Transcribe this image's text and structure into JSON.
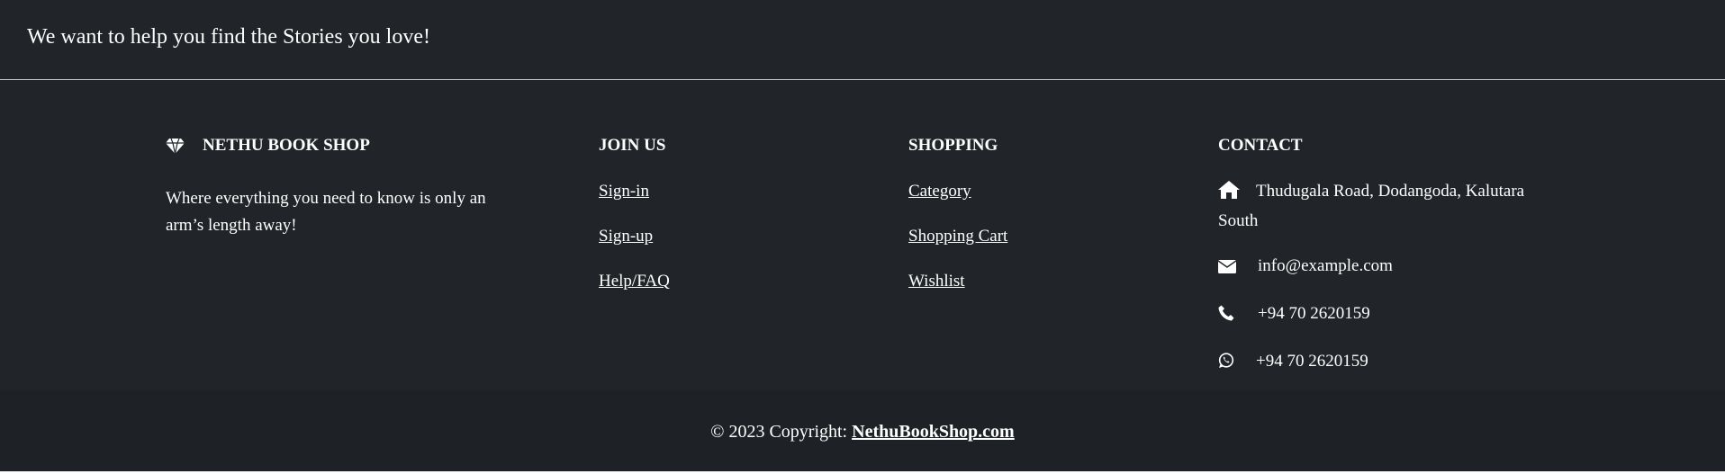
{
  "tagline": "We want to help you find the Stories you love!",
  "brand": {
    "icon": "gem-icon",
    "name": "NETHU BOOK SHOP",
    "description": "Where everything you need to know is only an arm’s length away!"
  },
  "join_us": {
    "heading": "JOIN US",
    "links": [
      "Sign-in",
      "Sign-up",
      "Help/FAQ"
    ]
  },
  "shopping": {
    "heading": "SHOPPING",
    "links": [
      "Category",
      "Shopping Cart",
      "Wishlist"
    ]
  },
  "contact": {
    "heading": "CONTACT",
    "address": "Thudugala Road, Dodangoda, Kalutara South",
    "email": "info@example.com",
    "phone": "+94 70 2620159",
    "whatsapp": "+94 70 2620159"
  },
  "copyright": {
    "prefix": "© 2023 Copyright:",
    "site": "NethuBookShop.com"
  },
  "colors": {
    "background": "#212529",
    "bottom_band": "#1e2226",
    "text": "#ffffff"
  }
}
